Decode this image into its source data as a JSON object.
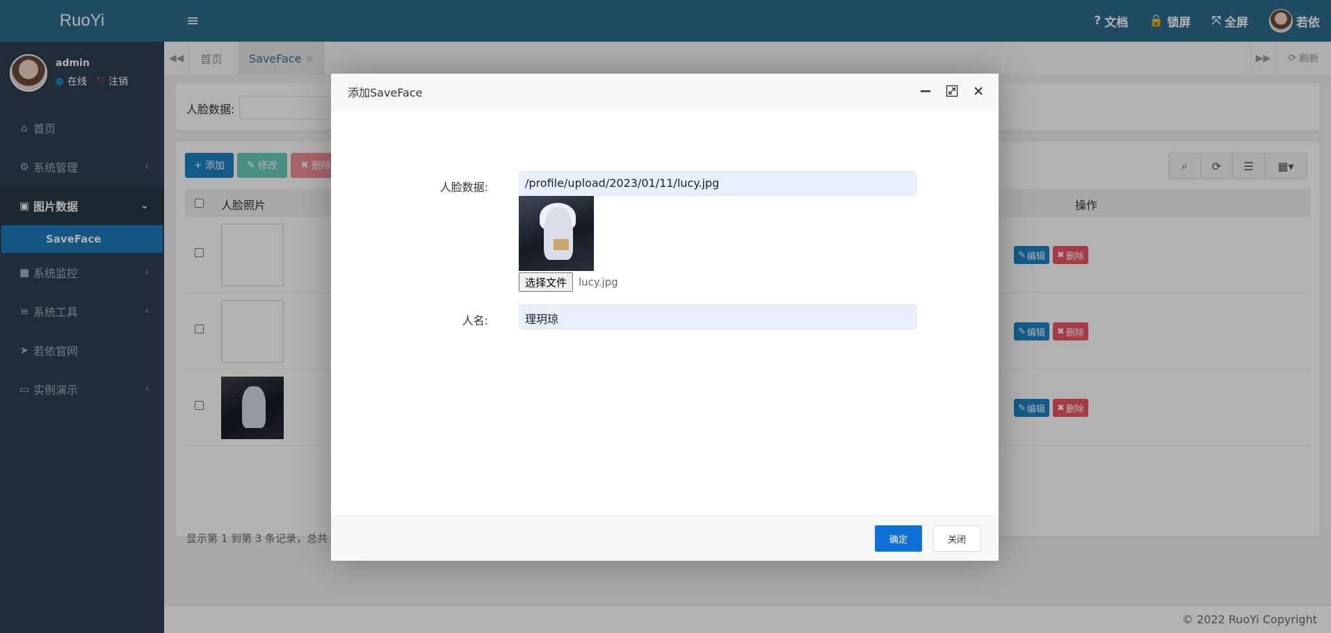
{
  "brand": "RuoYi",
  "user": {
    "name": "admin",
    "status": "在线",
    "logout": "注销"
  },
  "sidebar": {
    "items": [
      {
        "label": "首页",
        "icon": "home-icon"
      },
      {
        "label": "系统管理",
        "icon": "gear-icon"
      },
      {
        "label": "图片数据",
        "icon": "image-icon"
      },
      {
        "label": "SaveFace"
      },
      {
        "label": "系统监控",
        "icon": "video-icon"
      },
      {
        "label": "系统工具",
        "icon": "bars-icon"
      },
      {
        "label": "若依官网",
        "icon": "send-icon"
      },
      {
        "label": "实例演示",
        "icon": "desktop-icon"
      }
    ]
  },
  "topbar": {
    "doc": "文档",
    "lock": "锁屏",
    "fullscreen": "全屏",
    "username": "若依"
  },
  "tabs": {
    "home": "首页",
    "current": "SaveFace",
    "refresh": "刷新"
  },
  "search": {
    "label": "人脸数据:"
  },
  "toolbar": {
    "add": "添加",
    "edit": "修改",
    "delete": "删除"
  },
  "table": {
    "headers": {
      "photo": "人脸照片",
      "actions": "操作"
    },
    "row_actions": {
      "edit": "编辑",
      "delete": "删除"
    },
    "pager": "显示第 1 到第 3 条记录，总共"
  },
  "footer": "© 2022 RuoYi Copyright",
  "modal": {
    "title": "添加SaveFace",
    "face_label": "人脸数据:",
    "face_value": "/profile/upload/2023/01/11/lucy.jpg",
    "file_button": "选择文件",
    "file_name": "lucy.jpg",
    "name_label": "人名:",
    "name_value": "理玥琼",
    "ok": "确定",
    "cancel": "关闭"
  },
  "colors": {
    "sidebar": "#2f4050",
    "header": "#2f6d8f",
    "primary": "#1c84c6",
    "danger": "#ed5565",
    "success": "#1ab394"
  }
}
